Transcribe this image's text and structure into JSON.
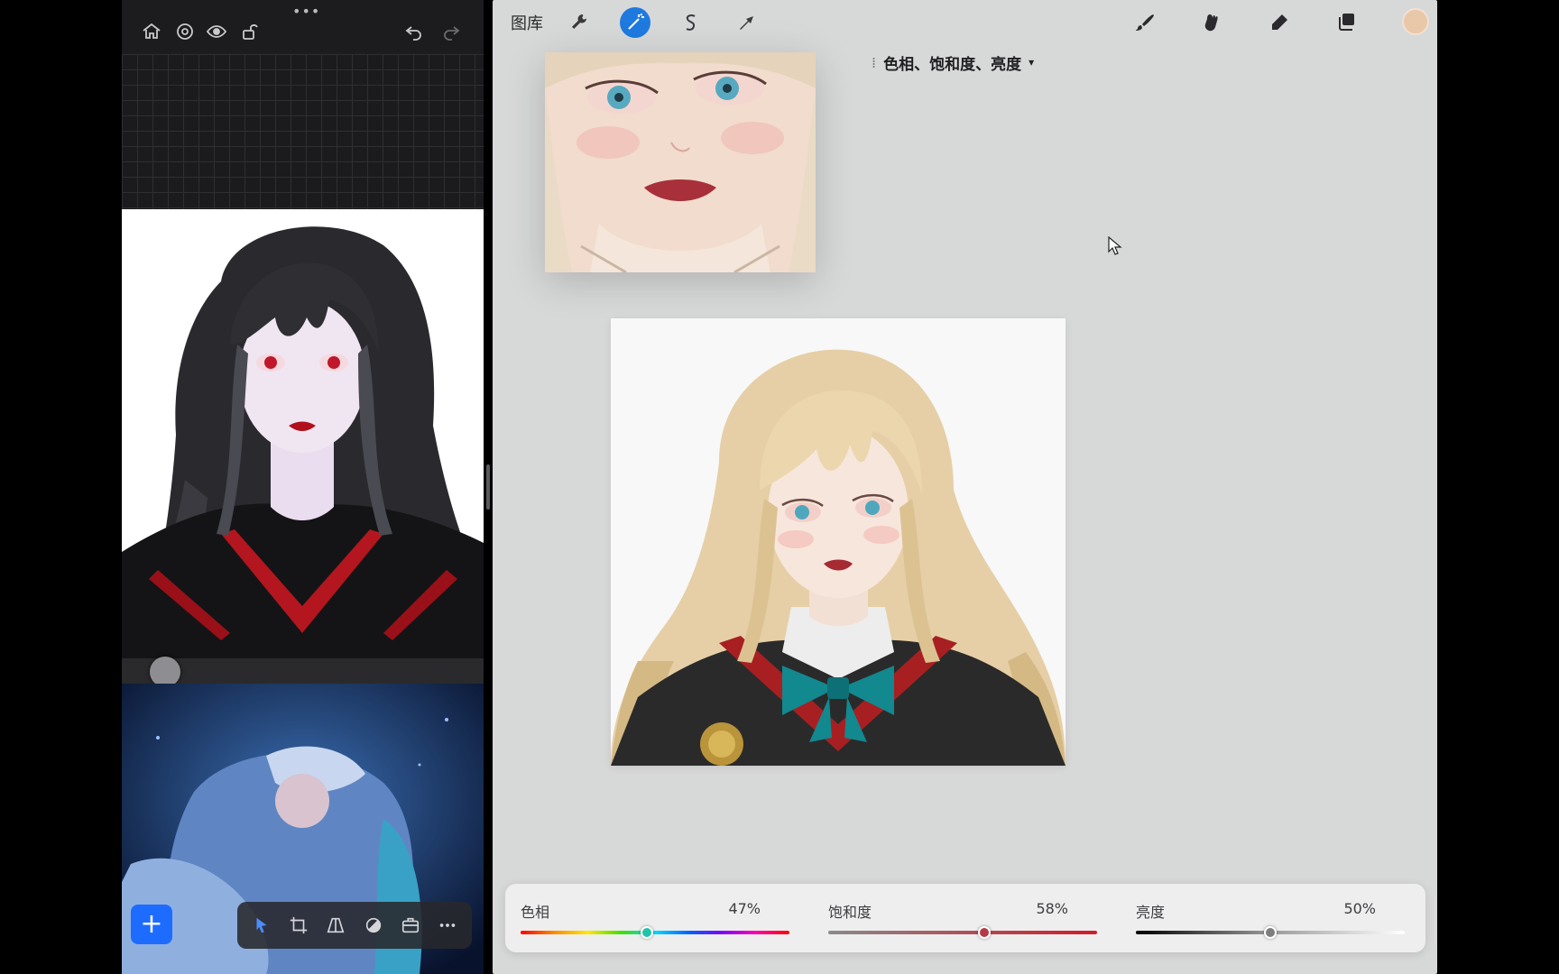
{
  "left_panel": {
    "toolbar": {
      "icons": [
        "home-icon",
        "settings-icon",
        "eye-icon",
        "unlock-icon",
        "undo-icon",
        "redo-icon"
      ]
    },
    "bottom_tools": {
      "add_label": "+",
      "icons": [
        "select-arrow-icon",
        "crop-icon",
        "perspective-icon",
        "adjust-tone-icon",
        "toolbox-icon",
        "more-icon"
      ]
    }
  },
  "topbar": {
    "gallery_label": "图库",
    "icons": [
      "wrench-icon",
      "adjustments-wand-icon",
      "selection-icon",
      "transform-arrow-icon",
      "brush-icon",
      "smudge-icon",
      "eraser-icon",
      "layers-icon"
    ],
    "active_tool": "adjustments-wand-icon",
    "color_swatch": "#e9c7a9"
  },
  "adjustment": {
    "title": "色相、饱和度、亮度",
    "caret": "▾",
    "sliders": [
      {
        "key": "hue",
        "label": "色相",
        "value_text": "47%",
        "value": 0.47,
        "gradient": "hue"
      },
      {
        "key": "saturation",
        "label": "饱和度",
        "value_text": "58%",
        "value": 0.58,
        "gradient": "saturation"
      },
      {
        "key": "brightness",
        "label": "亮度",
        "value_text": "50%",
        "value": 0.5,
        "gradient": "brightness"
      }
    ]
  },
  "colors": {
    "accent": "#1f7ae0",
    "add_button": "#1e6bff",
    "canvas_bg": "#d7d8d8"
  }
}
